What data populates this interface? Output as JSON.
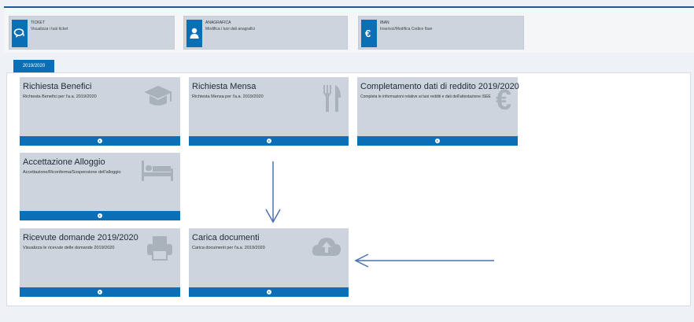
{
  "quicklinks": [
    {
      "title": "TICKET",
      "subtitle": "Visualizza i tuoi ticket",
      "icon": "chat-icon"
    },
    {
      "title": "ANAGRAFICA",
      "subtitle": "Modifica i tuoi dati anagrafici",
      "icon": "user-icon"
    },
    {
      "title": "IBAN",
      "subtitle": "Inserisci/Modifica Codice Iban",
      "icon": "euro-icon"
    }
  ],
  "tab": {
    "label": "2019/2020"
  },
  "cards": [
    {
      "title": "Richiesta Benefici",
      "description": "Richiesta Benefici per l'a.a. 2019/2020",
      "icon": "graduation-cap-icon"
    },
    {
      "title": "Richiesta Mensa",
      "description": "Richiesta Mensa per l'a.a. 2019/2020",
      "icon": "cutlery-icon"
    },
    {
      "title": "Completamento dati di reddito 2019/2020",
      "description": "Completa le informazioni relative ai tuoi redditi e dati dell'attestazione ISEE",
      "icon": "euro-icon"
    },
    {
      "title": "Accettazione Alloggio",
      "description": "Accettazione/Riconferma/Sospensione dell'alloggio",
      "icon": "bed-icon"
    },
    {
      "title": "Ricevute domande 2019/2020",
      "description": "Visualizza le ricevute delle domande 2019/2020",
      "icon": "printer-icon"
    },
    {
      "title": "Carica documenti",
      "description": "Carica documenti per l'a.a. 2019/2020",
      "icon": "cloud-upload-icon"
    }
  ],
  "colors": {
    "accent": "#0a6fb4",
    "card_bg": "#cdd4dd",
    "icon_gray": "#a9b1bb",
    "annotation_arrow": "#4a72b0"
  }
}
